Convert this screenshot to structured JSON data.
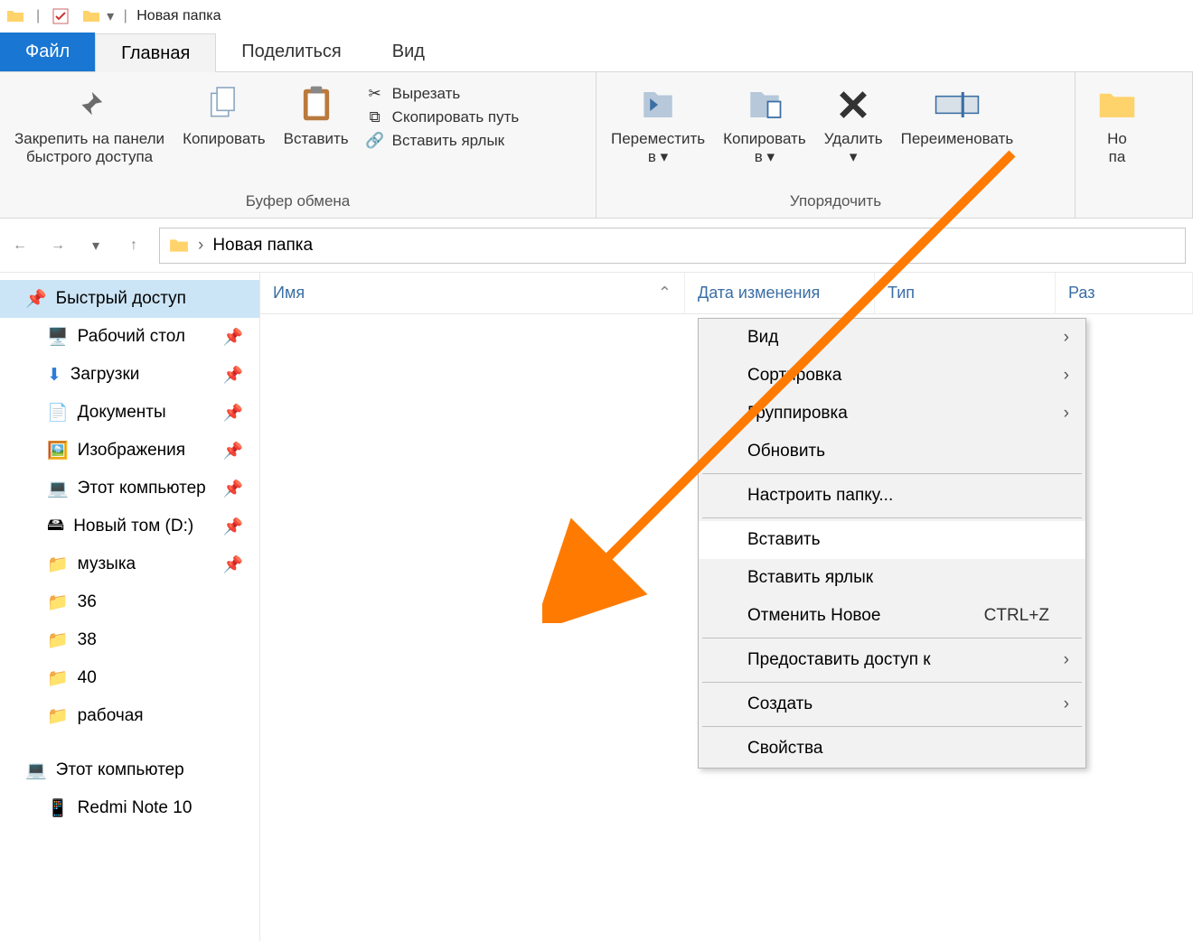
{
  "titlebar": {
    "title": "Новая папка"
  },
  "tabs": {
    "file": "Файл",
    "home": "Главная",
    "share": "Поделиться",
    "view": "Вид"
  },
  "ribbon": {
    "clipboard": {
      "label": "Буфер обмена",
      "pin": "Закрепить на панели\nбыстрого доступа",
      "copy": "Копировать",
      "paste": "Вставить",
      "cut": "Вырезать",
      "copy_path": "Скопировать путь",
      "paste_shortcut": "Вставить ярлык"
    },
    "organize": {
      "label": "Упорядочить",
      "move_to": "Переместить\nв ▾",
      "copy_to": "Копировать\nв ▾",
      "delete": "Удалить\n▾",
      "rename": "Переименовать"
    },
    "new": {
      "new_partial": "Но\nпа"
    }
  },
  "address": {
    "path": "Новая папка"
  },
  "columns": {
    "name": "Имя",
    "date": "Дата изменения",
    "type": "Тип",
    "size": "Раз"
  },
  "sidebar": {
    "quick_access": "Быстрый доступ",
    "items": [
      {
        "label": "Рабочий стол",
        "icon": "desktop",
        "pinned": true
      },
      {
        "label": "Загрузки",
        "icon": "downloads",
        "pinned": true
      },
      {
        "label": "Документы",
        "icon": "documents",
        "pinned": true
      },
      {
        "label": "Изображения",
        "icon": "pictures",
        "pinned": true
      },
      {
        "label": "Этот компьютер",
        "icon": "pc",
        "pinned": true
      },
      {
        "label": "Новый том (D:)",
        "icon": "drive",
        "pinned": true
      },
      {
        "label": "музыка",
        "icon": "folder",
        "pinned": true
      },
      {
        "label": "36",
        "icon": "folder",
        "pinned": false
      },
      {
        "label": "38",
        "icon": "folder",
        "pinned": false
      },
      {
        "label": "40",
        "icon": "folder",
        "pinned": false
      },
      {
        "label": "рабочая",
        "icon": "folder",
        "pinned": false
      }
    ],
    "this_pc": "Этот компьютер",
    "device": "Redmi Note 10"
  },
  "context_menu": {
    "view": "Вид",
    "sort": "Сортировка",
    "group": "Группировка",
    "refresh": "Обновить",
    "customize": "Настроить папку...",
    "paste": "Вставить",
    "paste_shortcut": "Вставить ярлык",
    "undo_new": "Отменить Новое",
    "undo_shortcut": "CTRL+Z",
    "share_access": "Предоставить доступ к",
    "create": "Создать",
    "properties": "Свойства"
  }
}
